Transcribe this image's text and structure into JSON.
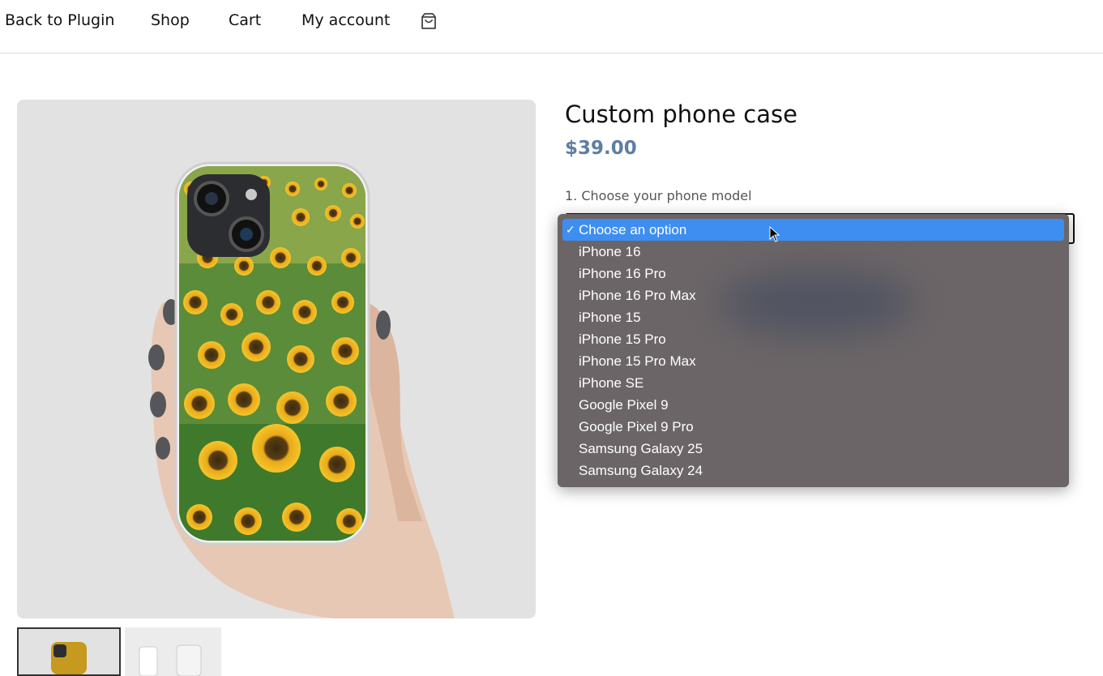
{
  "nav": {
    "back": "Back to Plugin",
    "shop": "Shop",
    "cart": "Cart",
    "account": "My account",
    "cart_icon": "shopping-bag-icon"
  },
  "product": {
    "title": "Custom phone case",
    "price": "$39.00",
    "price_color": "#5d7fa1"
  },
  "variation": {
    "label": "1. Choose your phone model",
    "selected_value": "Choose an option",
    "options": [
      "Choose an option",
      "iPhone 16",
      "iPhone 16 Pro",
      "iPhone 16 Pro Max",
      "iPhone 15",
      "iPhone 15 Pro",
      "iPhone 15 Pro Max",
      "iPhone SE",
      "Google Pixel 9",
      "Google Pixel 9 Pro",
      "Samsung Galaxy 25",
      "Samsung Galaxy 24"
    ],
    "check_mark": "✓",
    "highlight_color": "#3e8ef1"
  }
}
